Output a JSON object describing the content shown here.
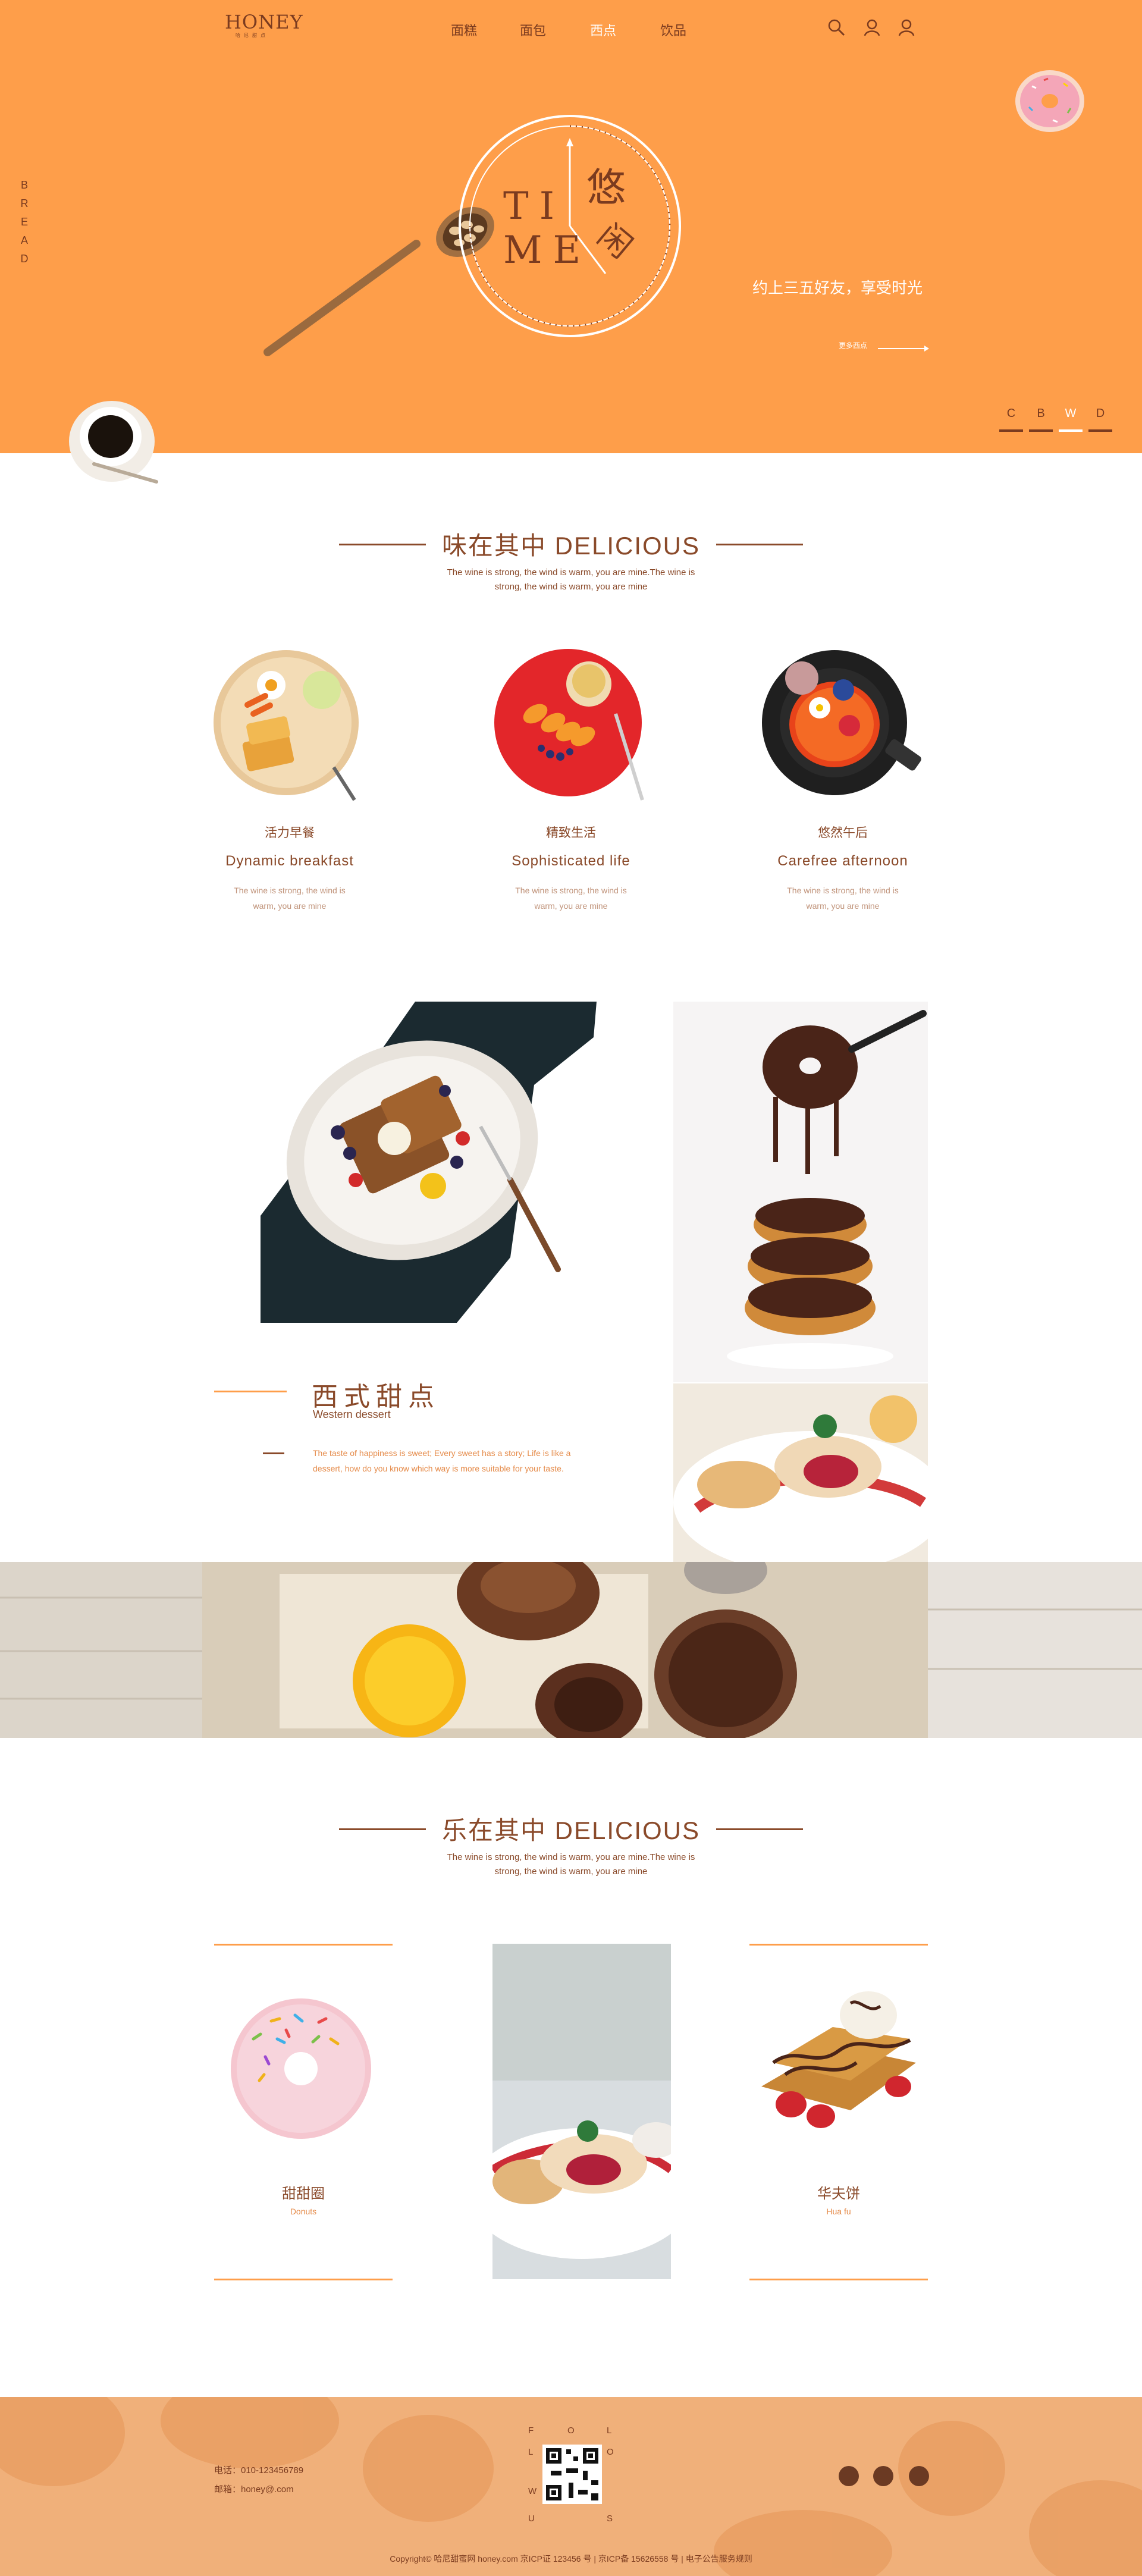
{
  "header": {
    "logo_name": "HONEY",
    "logo_sub": "哈尼甜点",
    "nav": [
      "面糕",
      "面包",
      "西点",
      "饮品"
    ],
    "active_nav": 2,
    "icons": [
      "search-icon",
      "user-icon",
      "account-icon"
    ]
  },
  "hero": {
    "side_letters": [
      "B",
      "R",
      "E",
      "A",
      "D"
    ],
    "time_letters": [
      "TI",
      "ME"
    ],
    "clock_text": [
      "悠",
      "闲"
    ],
    "slogan": "约上三五好友，享受时光",
    "more_label": "更多西点",
    "dots": [
      "C",
      "B",
      "W",
      "D"
    ],
    "active_dot": 2,
    "colors": {
      "accent": "#fe9e4a",
      "brown": "#8a4a2a",
      "dark": "#7b3b1f"
    }
  },
  "section1": {
    "title": "味在其中 DELICIOUS",
    "subtitle": "The wine is strong, the wind is warm, you are mine.The wine is strong, the wind is warm, you are mine",
    "features": [
      {
        "zh": "活力早餐",
        "en": "Dynamic breakfast",
        "desc": "The wine is strong, the wind is warm, you are mine"
      },
      {
        "zh": "精致生活",
        "en": "Sophisticated life",
        "desc": "The wine is strong, the wind is warm, you are mine"
      },
      {
        "zh": "悠然午后",
        "en": "Carefree afternoon",
        "desc": "The wine is strong, the wind is warm, you are mine"
      }
    ]
  },
  "dessert": {
    "title": "西式甜点",
    "subtitle": "Western dessert",
    "text": "The taste of happiness is sweet; Every sweet has a story; Life is like a dessert, how do you know which way is more suitable for your taste."
  },
  "section2": {
    "title": "乐在其中 DELICIOUS",
    "subtitle": "The wine is strong, the wind is warm, you are mine.The wine is strong, the wind is warm, you are mine",
    "cards": [
      {
        "zh": "甜甜圈",
        "en": "Donuts"
      },
      {
        "zh": "华夫饼",
        "en": "Hua fu"
      }
    ]
  },
  "footer": {
    "phone": "电话：010-123456789",
    "email": "邮箱：honey@.com",
    "follow_top": [
      "F",
      "O",
      "L",
      "L"
    ],
    "follow_bottom": [
      "O",
      "W",
      "U",
      "S"
    ],
    "social": [
      "weibo-icon",
      "qq-icon",
      "wechat-icon"
    ],
    "copyright": "Copyright© 哈尼甜蜜网 honey.com 京ICP证 123456 号 | 京ICP备 15626558 号 | 电子公告服务规则"
  }
}
